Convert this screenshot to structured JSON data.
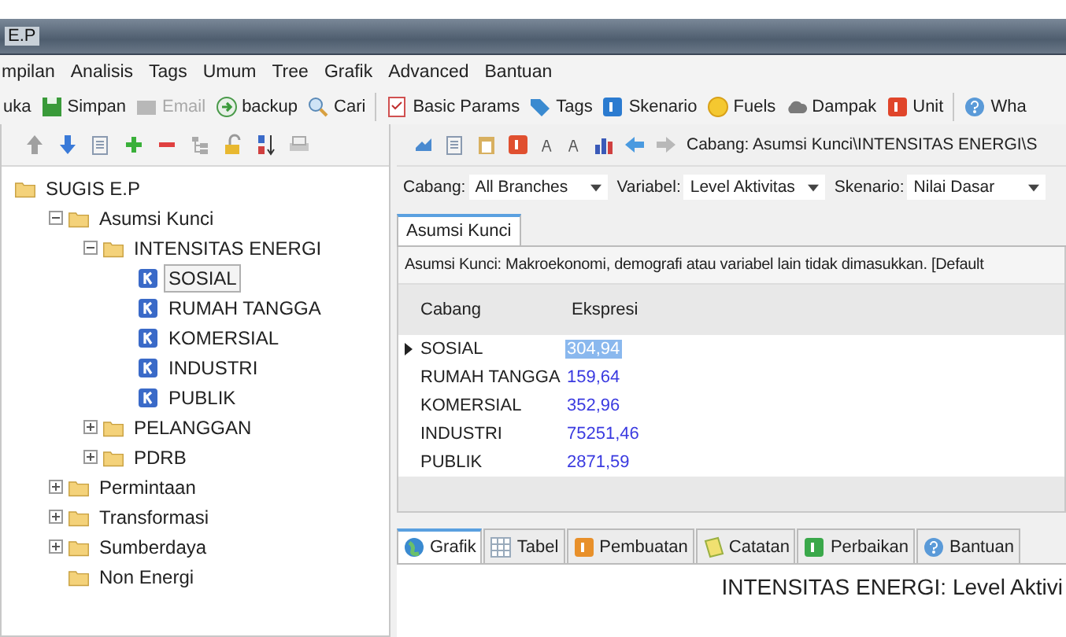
{
  "window": {
    "title": "E.P"
  },
  "menu": [
    "mpilan",
    "Analisis",
    "Tags",
    "Umum",
    "Tree",
    "Grafik",
    "Advanced",
    "Bantuan"
  ],
  "toolbar": [
    {
      "label": "uka",
      "disabled": false
    },
    {
      "label": "Simpan",
      "disabled": false
    },
    {
      "label": "Email",
      "disabled": true
    },
    {
      "label": "backup",
      "disabled": false
    },
    {
      "label": "Cari",
      "disabled": false
    },
    {
      "label": "Basic Params",
      "disabled": false
    },
    {
      "label": "Tags",
      "disabled": false
    },
    {
      "label": "Skenario",
      "disabled": false
    },
    {
      "label": "Fuels",
      "disabled": false
    },
    {
      "label": "Dampak",
      "disabled": false
    },
    {
      "label": "Unit",
      "disabled": false
    },
    {
      "label": "Wha",
      "disabled": false
    }
  ],
  "tree": [
    {
      "label": "SUGIS E.P",
      "kind": "folder",
      "selected": false,
      "children": [
        {
          "label": "Asumsi Kunci",
          "kind": "folder",
          "expanded": true,
          "selected": false,
          "children": [
            {
              "label": "INTENSITAS ENERGI",
              "kind": "folder",
              "expanded": true,
              "selected": false,
              "children": [
                {
                  "label": "SOSIAL",
                  "kind": "key",
                  "selected": true
                },
                {
                  "label": "RUMAH TANGGA",
                  "kind": "key",
                  "selected": false
                },
                {
                  "label": "KOMERSIAL",
                  "kind": "key",
                  "selected": false
                },
                {
                  "label": "INDUSTRI",
                  "kind": "key",
                  "selected": false
                },
                {
                  "label": "PUBLIK",
                  "kind": "key",
                  "selected": false
                }
              ]
            },
            {
              "label": "PELANGGAN",
              "kind": "folder",
              "expanded": false,
              "selected": false
            },
            {
              "label": "PDRB",
              "kind": "folder",
              "expanded": false,
              "selected": false
            }
          ]
        },
        {
          "label": "Permintaan",
          "kind": "folder",
          "expanded": false,
          "selected": false
        },
        {
          "label": "Transformasi",
          "kind": "folder",
          "expanded": false,
          "selected": false
        },
        {
          "label": "Sumberdaya",
          "kind": "folder",
          "expanded": false,
          "selected": false
        },
        {
          "label": "Non Energi",
          "kind": "folder",
          "selected": false
        }
      ]
    }
  ],
  "path": "Cabang: Asumsi Kunci\\INTENSITAS ENERGI\\S",
  "filters": [
    {
      "label": "Cabang:",
      "value": "All Branches"
    },
    {
      "label": "Variabel:",
      "value": "Level Aktivitas"
    },
    {
      "label": "Skenario:",
      "value": "Nilai Dasar"
    }
  ],
  "tabs": [
    {
      "label": "Asumsi Kunci",
      "selected": true
    }
  ],
  "description": "Asumsi Kunci: Makroekonomi, demografi atau variabel lain tidak dimasukkan. [Default",
  "table": {
    "columns": [
      "Cabang",
      "Ekspresi"
    ],
    "rows": [
      {
        "cabang": "SOSIAL",
        "ekspresi": "304,94",
        "selected": true
      },
      {
        "cabang": "RUMAH TANGGA",
        "ekspresi": "159,64",
        "selected": false
      },
      {
        "cabang": "KOMERSIAL",
        "ekspresi": "352,96",
        "selected": false
      },
      {
        "cabang": "INDUSTRI",
        "ekspresi": "75251,46",
        "selected": false
      },
      {
        "cabang": "PUBLIK",
        "ekspresi": "2871,59",
        "selected": false
      }
    ]
  },
  "bottom_tabs": [
    {
      "label": "Grafik",
      "selected": true
    },
    {
      "label": "Tabel",
      "selected": false
    },
    {
      "label": "Pembuatan",
      "selected": false
    },
    {
      "label": "Catatan",
      "selected": false
    },
    {
      "label": "Perbaikan",
      "selected": false
    },
    {
      "label": "Bantuan",
      "selected": false
    }
  ],
  "chart_title": "INTENSITAS ENERGI: Level Aktivi"
}
